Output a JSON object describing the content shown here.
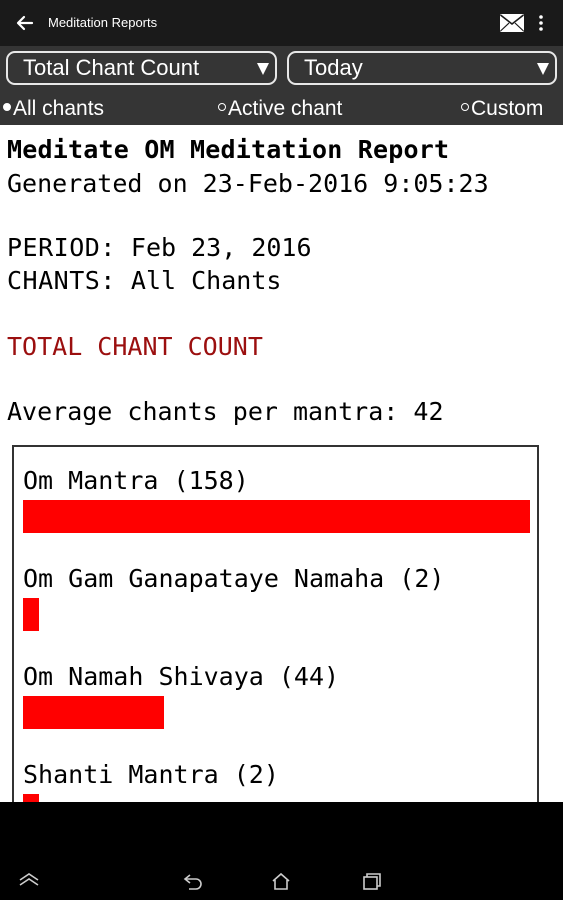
{
  "app": {
    "title": "Meditation Reports"
  },
  "controls": {
    "metric_select": "Total Chant Count",
    "period_select": "Today",
    "radios": [
      {
        "label": "All chants",
        "selected": true
      },
      {
        "label": "Active chant",
        "selected": false
      },
      {
        "label": "Custom",
        "selected": false
      }
    ]
  },
  "report": {
    "heading": "Meditate OM Meditation Report",
    "generated": "Generated on 23-Feb-2016 9:05:23",
    "period_label": "PERIOD:",
    "period_value": " Feb 23, 2016",
    "chants_label": "CHANTS:",
    "chants_value": " All Chants",
    "section_title": "TOTAL CHANT COUNT",
    "avg_label": "Average chants per mantra:",
    "avg_value": " 42"
  },
  "chart_data": {
    "type": "bar",
    "orientation": "horizontal",
    "categories": [
      "Om Mantra",
      "Om Gam Ganapataye Namaha",
      "Om Namah Shivaya",
      "Shanti Mantra"
    ],
    "values": [
      158,
      2,
      44,
      2
    ],
    "labels": [
      "Om Mantra (158)",
      "Om Gam Ganapataye Namaha (2)",
      "Om Namah Shivaya (44)",
      "Shanti Mantra (2)"
    ],
    "bar_color": "#ff0000"
  },
  "colors": {
    "section": "#9b0f0f",
    "bar": "#ff0000",
    "actionbar": "#1a1a1a",
    "controls": "#353535"
  },
  "navbar": {
    "icons": [
      "keyboard-hide-icon",
      "back-icon",
      "home-icon",
      "recents-icon"
    ]
  }
}
